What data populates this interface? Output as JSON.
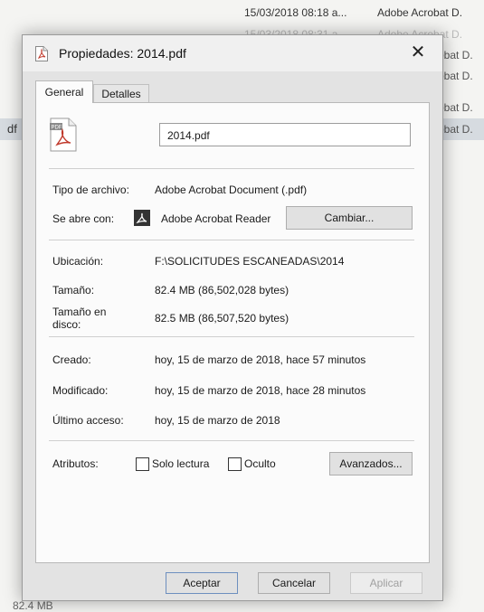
{
  "background": {
    "rows": [
      {
        "date": "15/03/2018 08:18 a...",
        "type": "Adobe Acrobat D.",
        "faded": false
      },
      {
        "date": "15/03/2018 08:31 a...",
        "type": "Adobe Acrobat D.",
        "faded": true
      }
    ],
    "right_column": [
      "robat D.",
      "robat D.",
      "robat D.",
      "robat D."
    ],
    "selected_prefix": "df",
    "status_size": "82.4 MB"
  },
  "dialog": {
    "title": "Propiedades: 2014.pdf",
    "close": "✕",
    "tabs": [
      "General",
      "Detalles"
    ],
    "file_name": "2014.pdf",
    "file_type_label": "Tipo de archivo:",
    "file_type_value": "Adobe Acrobat Document (.pdf)",
    "opens_with_label": "Se abre con:",
    "opens_with_value": "Adobe Acrobat Reader",
    "change_button": "Cambiar...",
    "location_label": "Ubicación:",
    "location_value": "F:\\SOLICITUDES ESCANEADAS\\2014",
    "size_label": "Tamaño:",
    "size_value": "82.4 MB (86,502,028 bytes)",
    "disk_size_label_1": "Tamaño en",
    "disk_size_label_2": "disco:",
    "disk_size_value": "82.5 MB (86,507,520 bytes)",
    "created_label": "Creado:",
    "created_value": "hoy, 15 de marzo de 2018, hace 57 minutos",
    "modified_label": "Modificado:",
    "modified_value": "hoy, 15 de marzo de 2018, hace 28 minutos",
    "accessed_label": "Último acceso:",
    "accessed_value": "hoy, 15 de marzo de 2018",
    "attributes_label": "Atributos:",
    "readonly_label": "Solo lectura",
    "hidden_label": "Oculto",
    "advanced_button": "Avanzados...",
    "ok_button": "Aceptar",
    "cancel_button": "Cancelar",
    "apply_button": "Aplicar"
  }
}
